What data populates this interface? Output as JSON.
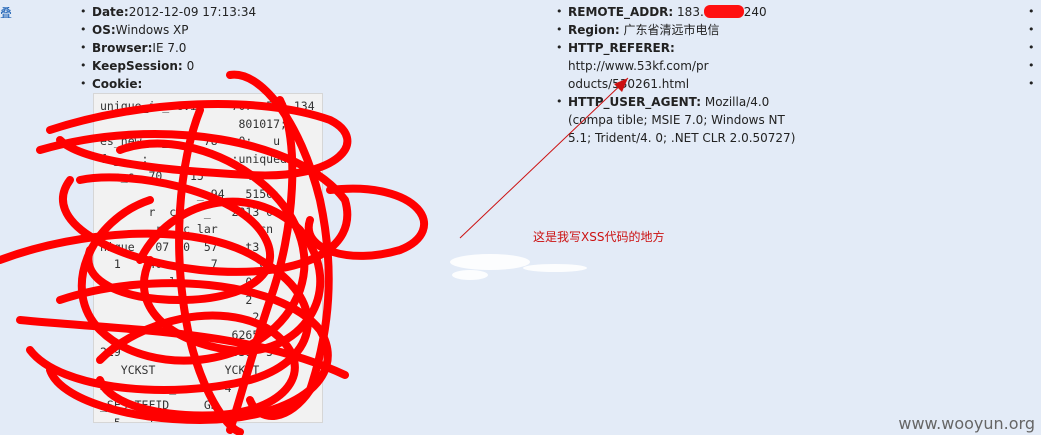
{
  "edge_glyph": "叠",
  "left_fields": [
    {
      "key": "Date:",
      "value": "2012-12-09 17:13:34"
    },
    {
      "key": "OS:",
      "value": "Windows XP"
    },
    {
      "key": "Browser:",
      "value": "IE 7.0"
    },
    {
      "key": "KeepSession:",
      "value": "0"
    },
    {
      "key": "Cookie:",
      "value": ""
    }
  ],
  "cookie_lines": [
    "unique_in_revis    707  540 134",
    "                    801017;",
    "es_new_  _     78   0;   u",
    "fo_   ;            ;uniqued",
    "  e_s  70  _ 15      42",
    "              _ 94   5150;",
    "       r  c    _   2013 0",
    "        r  _c_lar      cn",
    "nique_  07 70  57    t3",
    "  1    40       7      07",
    "          l          0",
    "                     2",
    "                      2",
    "              _    6265",
    "219          8   12639  5",
    "   YCKST          YCKST",
    "=     e   _    0  4  ",
    "_SES_TEFID     GR   ",
    "  5    ( ;  YC",
    "      y_name="
  ],
  "mid_fields": [
    {
      "key": "REMOTE_ADDR:",
      "value": "183.",
      "value_tail": "240"
    },
    {
      "key": "Region:",
      "value": "广东省清远市电信"
    },
    {
      "key": "HTTP_REFERER:",
      "value": "http://www.53kf.com/pr oducts/530261.html"
    },
    {
      "key": "HTTP_USER_AGENT:",
      "value": "Mozilla/4.0 (compa tible; MSIE 7.0; Windows NT 5.1; Trident/4. 0; .NET CLR 2.0.50727)"
    }
  ],
  "annotation": "这是我写XSS代码的地方",
  "watermark": "www.wooyun.org",
  "colors": {
    "background": "#e3ebf7",
    "scribble": "#ff0000",
    "annotation": "#cc1111"
  }
}
